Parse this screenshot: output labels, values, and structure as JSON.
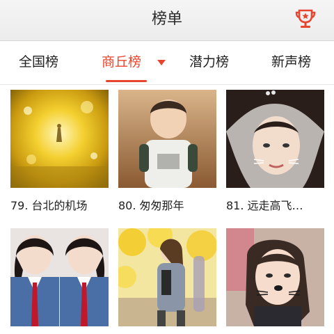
{
  "header": {
    "title": "榜单",
    "trophy_icon": "trophy-icon"
  },
  "tabs": [
    {
      "label": "全国榜",
      "active": false
    },
    {
      "label": "商丘榜",
      "active": true
    },
    {
      "label": "潜力榜",
      "active": false
    },
    {
      "label": "新声榜",
      "active": false
    }
  ],
  "accent_color": "#e8452e",
  "grid": {
    "items": [
      {
        "caption": "79. 台北的机场"
      },
      {
        "caption": "80. 匆匆那年"
      },
      {
        "caption": "81. 远走高飞…"
      },
      {
        "caption": ""
      },
      {
        "caption": ""
      },
      {
        "caption": ""
      }
    ]
  }
}
